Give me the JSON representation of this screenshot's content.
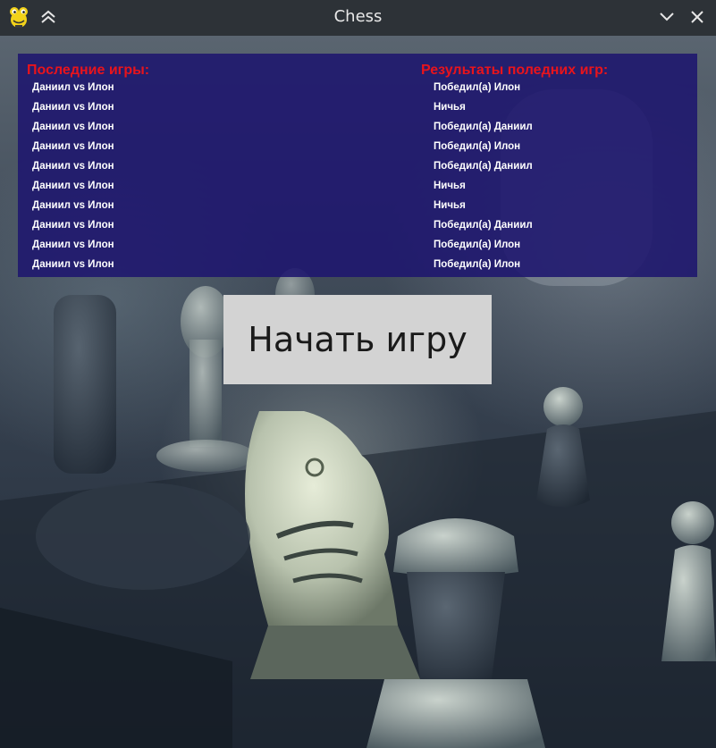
{
  "window": {
    "title": "Chess",
    "icons": {
      "app": "pygame-snake-icon",
      "shade": "double-chevron-up-icon",
      "minimize": "chevron-down-icon",
      "close": "close-icon"
    }
  },
  "panel": {
    "recent_games_title": "Последние игры:",
    "results_title": "Результаты поледних игр:",
    "games": [
      "Даниил vs Илон",
      "Даниил vs Илон",
      "Даниил vs Илон",
      "Даниил vs Илон",
      "Даниил vs Илон",
      "Даниил vs Илон",
      "Даниил vs Илон",
      "Даниил vs Илон",
      "Даниил vs Илон",
      "Даниил vs Илон"
    ],
    "results": [
      "Победил(а) Илон",
      "Ничья",
      "Победил(а) Даниил",
      "Победил(а) Илон",
      "Победил(а) Даниил",
      "Ничья",
      "Ничья",
      "Победил(а) Даниил",
      "Победил(а) Илон",
      "Победил(а) Илон"
    ],
    "colors": {
      "background": "#1e166e",
      "heading": "#e8141c",
      "text": "#ffffff"
    }
  },
  "start_button": {
    "label": "Начать игру",
    "background": "#d3d3d3"
  },
  "background_image": "chess-pieces-photo"
}
